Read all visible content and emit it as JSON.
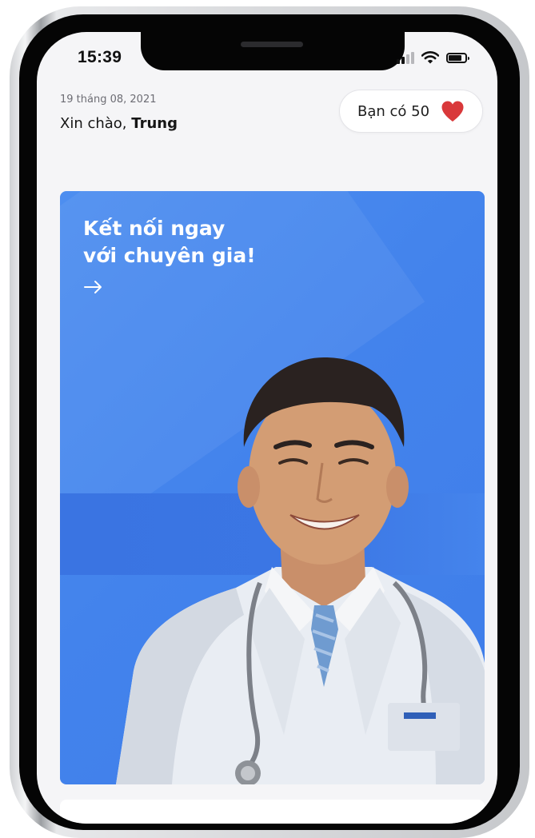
{
  "status_bar": {
    "time": "15:39",
    "icons": [
      "cellular-signal-icon",
      "wifi-icon",
      "battery-icon"
    ]
  },
  "header": {
    "date": "19 tháng 08, 2021",
    "greeting_prefix": "Xin chào, ",
    "user_name": "Trung"
  },
  "hearts_badge": {
    "label": "Bạn có 50",
    "icon": "heart-icon",
    "icon_color": "#d9383a"
  },
  "banner": {
    "title_line1": "Kết nối ngay",
    "title_line2": "với chuyên gia!",
    "arrow_icon": "arrow-right-icon",
    "background_color": "#4383ec",
    "image": "doctor-photo"
  }
}
